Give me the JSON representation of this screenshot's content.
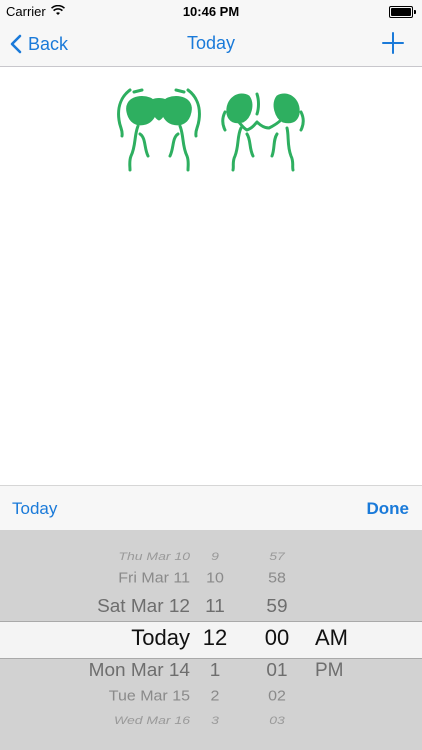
{
  "status_bar": {
    "carrier": "Carrier",
    "time": "10:46 PM"
  },
  "nav": {
    "back_label": "Back",
    "title": "Today"
  },
  "content": {
    "left_icon": "lungs-icon",
    "right_icon": "lungs-icon",
    "icon_color": "#2eaf60"
  },
  "picker_toolbar": {
    "today_label": "Today",
    "done_label": "Done"
  },
  "picker": {
    "dates": [
      "Thu Mar 10",
      "Fri Mar 11",
      "Sat Mar 12",
      "Today",
      "Mon Mar 14",
      "Tue Mar 15",
      "Wed Mar 16"
    ],
    "hours": [
      "9",
      "10",
      "11",
      "12",
      "1",
      "2",
      "3"
    ],
    "minutes": [
      "57",
      "58",
      "59",
      "00",
      "01",
      "02",
      "03"
    ],
    "ampm": [
      "AM",
      "PM"
    ],
    "selected": {
      "date": "Today",
      "hour": "12",
      "minute": "00",
      "ampm": "AM"
    }
  },
  "colors": {
    "accent": "#1a7ad9",
    "icon_green": "#2eaf60",
    "picker_bg": "#d2d2d2"
  }
}
